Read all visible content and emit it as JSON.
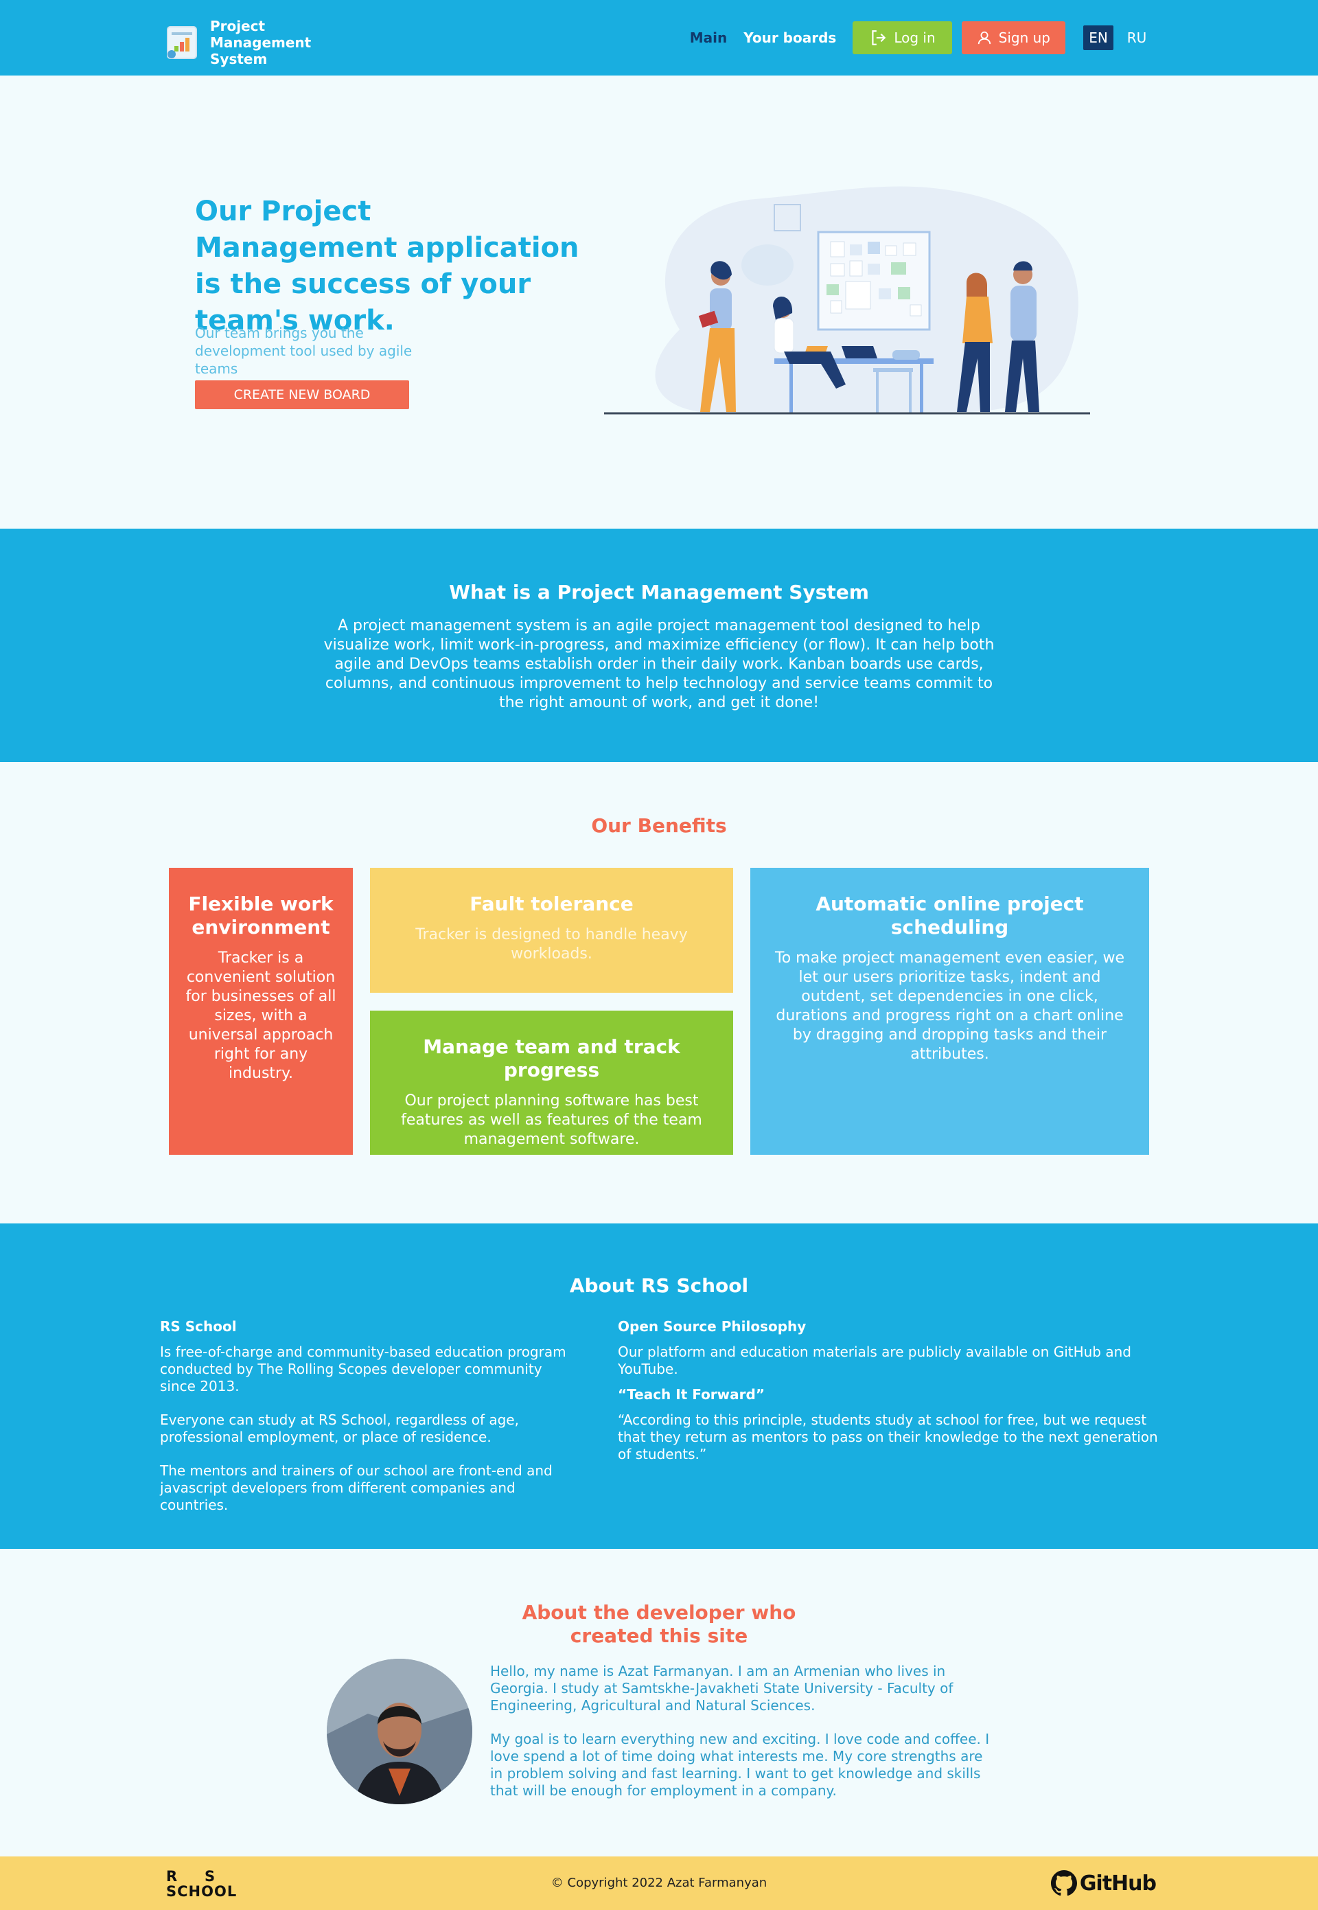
{
  "header": {
    "logo_text": "Project Management System",
    "nav": {
      "main": "Main",
      "boards": "Your boards"
    },
    "login": "Log in",
    "signup": "Sign up",
    "lang": {
      "en": "EN",
      "ru": "RU"
    }
  },
  "hero": {
    "title": "Our Project Management application is the success of your team's work.",
    "subtitle": "Our team brings you the development tool used by agile teams",
    "button": "CREATE NEW BOARD"
  },
  "what": {
    "title": "What is a Project Management System",
    "body": "A project management system is an agile project management tool designed to help visualize work, limit work-in-progress, and maximize efficiency (or flow). It can help both agile and DevOps teams establish order in their daily work. Kanban boards use cards, columns, and continuous improvement to help technology and service teams commit to the right amount of work, and get it done!"
  },
  "benefits": {
    "title": "Our Benefits",
    "cards": [
      {
        "title": "Flexible work environment",
        "text": "Tracker is a convenient solution for businesses of all sizes, with a universal approach right for any industry.",
        "color": "#f2654d"
      },
      {
        "title": "Fault tolerance",
        "text": "Tracker is designed to handle heavy workloads.",
        "color": "#f9d56d"
      },
      {
        "title": "Manage team and track progress",
        "text": "Our project planning software has best features as well as features of the team management software.",
        "color": "#8bc934"
      },
      {
        "title": "Automatic online project scheduling",
        "text": "To make project management even easier, we let our users prioritize tasks, indent and outdent, set dependencies in one click, durations and progress right on a chart online by dragging and dropping tasks and their attributes.",
        "color": "#55c1ed"
      }
    ]
  },
  "about": {
    "title": "About RS School",
    "left": {
      "heading": "RS School",
      "p1": "Is free-of-charge and community-based education program conducted by The Rolling Scopes developer community since 2013.",
      "p2": "Everyone can study at RS School, regardless of age, professional employment, or place of residence.",
      "p3": "The mentors and trainers of our school are front-end and javascript developers from different companies and countries."
    },
    "right": {
      "heading1": "Open Source Philosophy",
      "p1": "Our platform and education materials are publicly available on GitHub and YouTube.",
      "heading2": "“Teach It Forward”",
      "p2": "“According to this principle, students study at school for free, but we request that they return as mentors to pass on their knowledge to the next generation of students.”"
    }
  },
  "developer": {
    "title_line1": "About the developer who",
    "title_line2": "created this site",
    "p1": "Hello, my name is Azat Farmanyan. I am an Armenian who lives in Georgia. I study at Samtskhe-Javakheti State University - Faculty of Engineering, Agricultural and Natural Sciences.",
    "p2": "My goal is to learn everything new and exciting. I love code and coffee. I love spend a lot of time doing what interests me. My core strengths are in problem solving and fast learning. I want to get knowledge and skills that will be enough for employment in a company."
  },
  "footer": {
    "rs_logo": "RS SCHOOL",
    "copyright": "© Copyright 2022 Azat Farmanyan",
    "github": "GitHub"
  },
  "colors": {
    "primary": "#19aee0",
    "accent": "#f26b52",
    "green": "#8dc93b",
    "navy": "#103a6c",
    "yellow": "#f9d56d"
  },
  "icons": [
    "logo-icon",
    "login-icon",
    "user-icon",
    "github-icon"
  ]
}
